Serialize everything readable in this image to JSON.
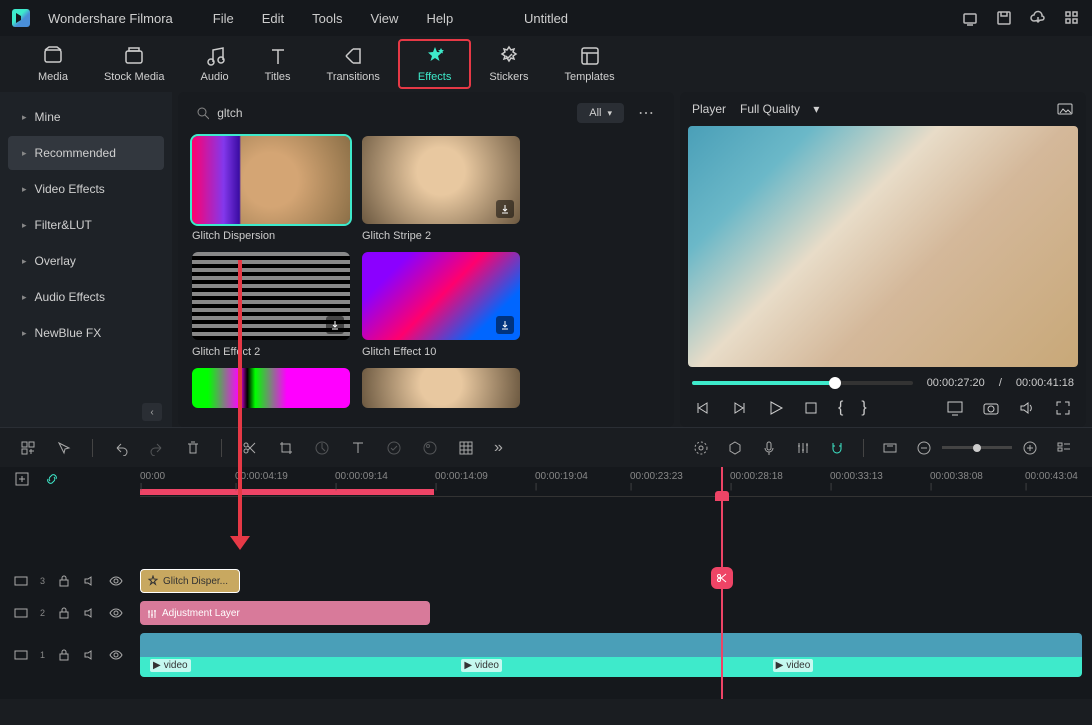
{
  "app": {
    "name": "Wondershare Filmora",
    "document": "Untitled"
  },
  "menu": [
    "File",
    "Edit",
    "Tools",
    "View",
    "Help"
  ],
  "tabs": [
    {
      "name": "media-tab",
      "label": "Media"
    },
    {
      "name": "stock-media-tab",
      "label": "Stock Media"
    },
    {
      "name": "audio-tab",
      "label": "Audio"
    },
    {
      "name": "titles-tab",
      "label": "Titles"
    },
    {
      "name": "transitions-tab",
      "label": "Transitions"
    },
    {
      "name": "effects-tab",
      "label": "Effects",
      "active": true,
      "highlighted": true
    },
    {
      "name": "stickers-tab",
      "label": "Stickers"
    },
    {
      "name": "templates-tab",
      "label": "Templates"
    }
  ],
  "sidebar": {
    "items": [
      {
        "label": "Mine"
      },
      {
        "label": "Recommended",
        "active": true
      },
      {
        "label": "Video Effects"
      },
      {
        "label": "Filter&LUT"
      },
      {
        "label": "Overlay"
      },
      {
        "label": "Audio Effects"
      },
      {
        "label": "NewBlue FX"
      }
    ]
  },
  "search": {
    "value": "gltch",
    "filter": "All"
  },
  "effects": [
    {
      "label": "Glitch Dispersion",
      "thumb": "glitch1",
      "selected": true
    },
    {
      "label": "Glitch Stripe 2",
      "thumb": "glitch2",
      "download": true
    },
    {
      "label": "Glitch Effect 2",
      "thumb": "glitch3",
      "download": true
    },
    {
      "label": "Glitch Effect 10",
      "thumb": "glitch4",
      "download": true
    }
  ],
  "preview": {
    "mode": "Player",
    "quality": "Full Quality",
    "current": "00:00:27:20",
    "duration": "00:00:41:18",
    "progress_pct": 65
  },
  "timeline": {
    "ticks": [
      "00:00",
      "00:00:04:19",
      "00:00:09:14",
      "00:00:14:09",
      "00:00:19:04",
      "00:00:23:23",
      "00:00:28:18",
      "00:00:33:13",
      "00:00:38:08",
      "00:00:43:04"
    ],
    "tracks": [
      {
        "index": 3,
        "clip": {
          "type": "effect",
          "label": "Glitch Disper..."
        }
      },
      {
        "index": 2,
        "clip": {
          "type": "adjustment",
          "label": "Adjustment Layer"
        }
      },
      {
        "index": 1,
        "clip": {
          "type": "video",
          "label": "video",
          "segments": 3
        }
      }
    ]
  }
}
